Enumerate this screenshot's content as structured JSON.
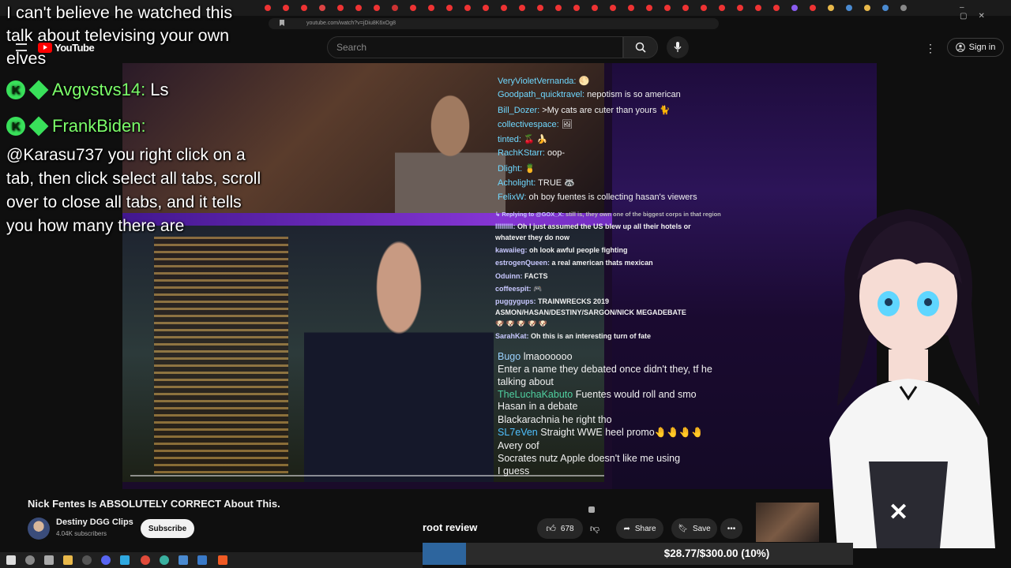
{
  "browser": {
    "url": "youtube.com/watch?v=jDiu8K6xOg8"
  },
  "header": {
    "logo_text": "YouTube",
    "search_placeholder": "Search",
    "signin_label": "Sign in"
  },
  "overlay": {
    "title": "I can't believe he watched this talk about televising your own elves",
    "badge_letter": "K",
    "line1_name": "Avgvstvs14:",
    "line1_msg": "Ls",
    "line2_name": "FrankBiden:",
    "line2_msg": "@Karasu737 you right click on a tab, then click select all tabs, scroll over to close all tabs, and it tells you how many there are"
  },
  "chat_top": [
    {
      "user": "VeryVioletVernanda:",
      "msg": "🌕"
    },
    {
      "user": "Goodpath_quicktravel:",
      "msg": "nepotism is so american"
    },
    {
      "user": "Bill_Dozer:",
      "msg": ">My cats are cuter than yours 🐈"
    },
    {
      "user": "collectivespace:",
      "msg": "🖼"
    },
    {
      "user": "tinted:",
      "msg": "🍒 🍌"
    },
    {
      "user": "RachKStarr:",
      "msg": "oop-"
    },
    {
      "user": "Dlight:",
      "msg": "🍍"
    },
    {
      "user": "Acholight:",
      "msg": "TRUE 🦝"
    },
    {
      "user": "FelixW:",
      "msg": "oh boy fuentes is collecting hasan's viewers"
    }
  ],
  "chat_mid": [
    {
      "user": "↳ Replying to @GOX_X:",
      "msg": "still is, they own one of the biggest corps in that region"
    },
    {
      "user": "lllllllll:",
      "msg": "Oh I just assumed the US blew up all their hotels or"
    },
    {
      "user": "",
      "msg": "whatever they do now"
    },
    {
      "user": "kawaiieg:",
      "msg": "oh look awful people fighting"
    },
    {
      "user": "estrogenQueen:",
      "msg": "a real american thats mexican"
    },
    {
      "user": "Oduinn:",
      "msg": "FACTS"
    },
    {
      "user": "coffeespit:",
      "msg": "🎮"
    },
    {
      "user": "puggygups:",
      "msg": "TRAINWRECKS 2019"
    },
    {
      "user": "",
      "msg": "ASMON/HASAN/DESTINY/SARGON/NICK MEGADEBATE"
    },
    {
      "user": "",
      "msg": "🐶 🐶 🐶 🐶 🐶"
    },
    {
      "user": "SarahKat:",
      "msg": "Oh this is an interesting turn of fate"
    }
  ],
  "chat_bottom": [
    {
      "user": "Bugo",
      "msg": "lmaoooooo"
    },
    {
      "user": "Enter a name",
      "msg": "they debated once didn't they, tf he"
    },
    {
      "user": "",
      "msg": "talking about"
    },
    {
      "user": "TheLuchaKabuto",
      "msg": "Fuentes would roll and smo"
    },
    {
      "user": "",
      "msg": "Hasan in a debate"
    },
    {
      "user": "Blackarachnia",
      "msg": "he right tho"
    },
    {
      "user": "SL7eVen",
      "msg": "Straight WWE heel promo🤚🤚🤚🤚"
    },
    {
      "user": "Avery",
      "msg": "oof"
    },
    {
      "user": "Socrates nutz",
      "msg": "Apple doesn't like me using"
    },
    {
      "user": "",
      "msg": "I guess"
    }
  ],
  "video": {
    "title": "Nick Fentes Is ABSOLUTELY CORRECT About This.",
    "channel": "Destiny DGG Clips",
    "subscribers": "4.04K subscribers",
    "subscribe_label": "Subscribe",
    "likes": "678",
    "share_label": "Share",
    "save_label": "Save",
    "more_label": "•••"
  },
  "stream": {
    "segment_label": "root review",
    "goal_text": "$28.77/$300.00 (10%)",
    "goal_progress": 0.1
  },
  "colors": {
    "accent_green": "#39e05a",
    "youtube_red": "#ff0000",
    "goal_blue": "#2f7fd0"
  }
}
